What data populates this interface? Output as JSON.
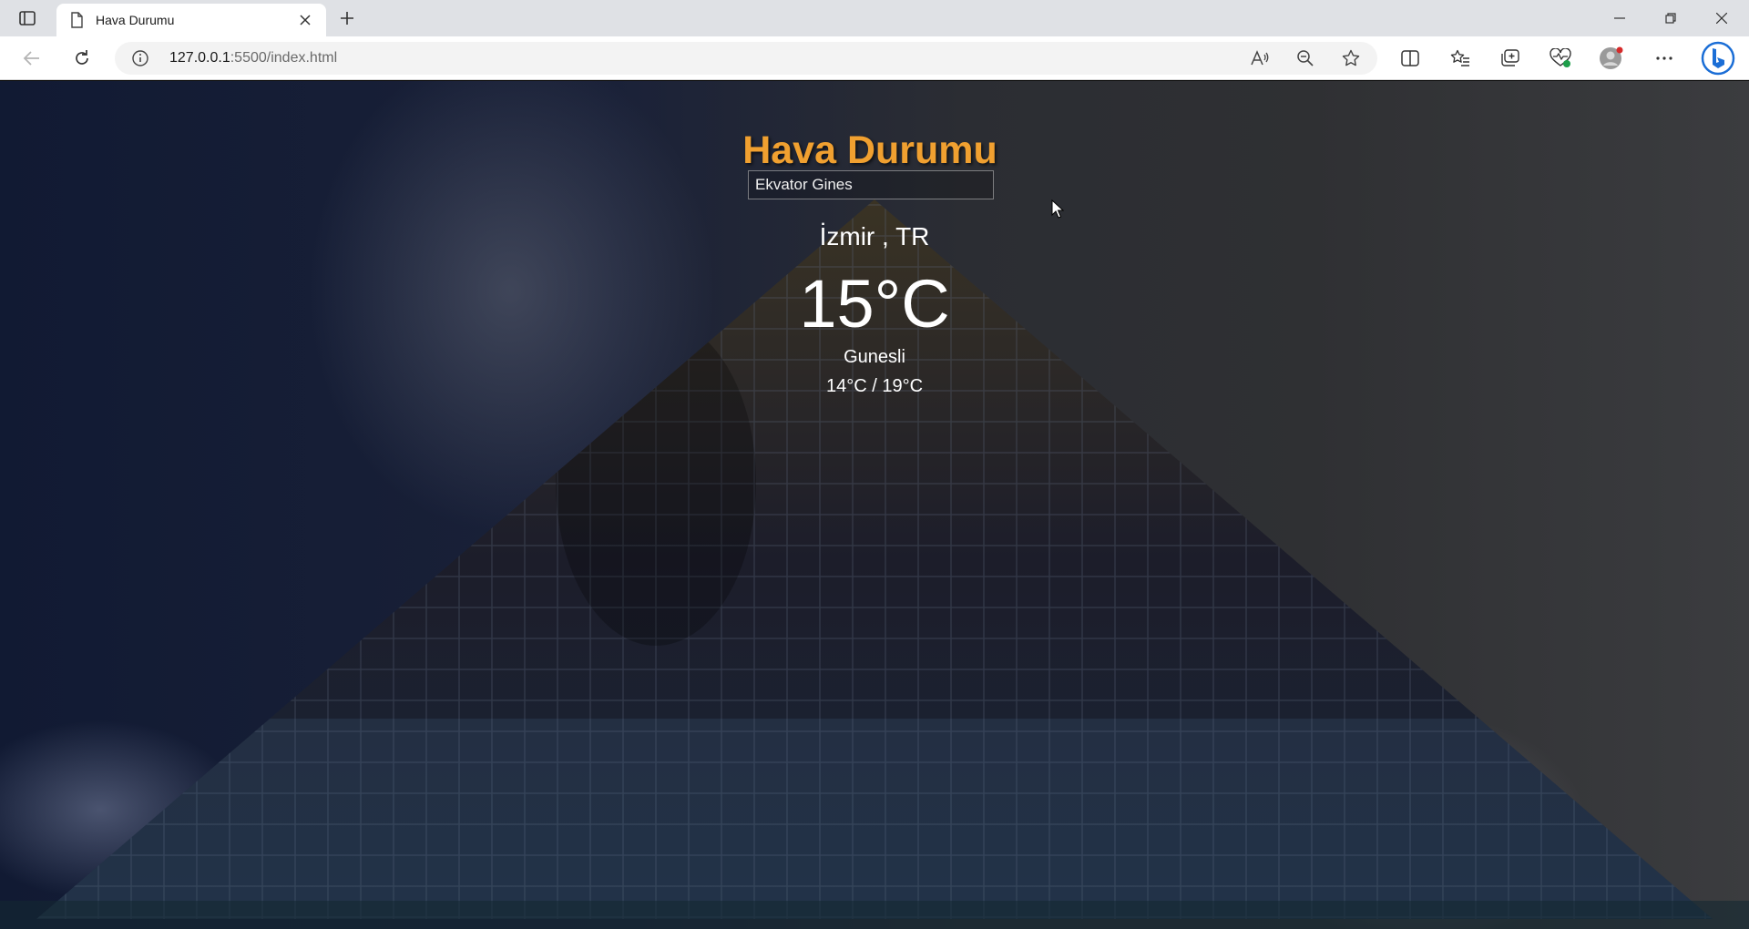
{
  "browser": {
    "tab_title": "Hava Durumu",
    "url_host": "127.0.0.1",
    "url_path": ":5500/index.html",
    "icons": {
      "sidebar": "tab-actions-icon",
      "page": "page-icon",
      "close_tab": "close-icon",
      "new_tab": "plus-icon",
      "back": "back-arrow-icon",
      "refresh": "refresh-icon",
      "info": "info-icon",
      "read_aloud": "read-aloud-icon",
      "zoom": "zoom-out-icon",
      "favorite": "star-icon",
      "split": "split-screen-icon",
      "favorites": "favorites-icon",
      "collections": "collections-icon",
      "health": "browser-essentials-icon",
      "profile": "profile-icon",
      "more": "more-icon",
      "bing": "bing-icon"
    }
  },
  "app": {
    "title": "Hava Durumu",
    "search_value": "Ekvator Gines",
    "city": "İzmir , TR",
    "temperature": "15°C",
    "description": "Gunesli",
    "min_max": "14°C / 19°C"
  },
  "colors": {
    "title": "#f0a030",
    "text": "#ffffff"
  }
}
